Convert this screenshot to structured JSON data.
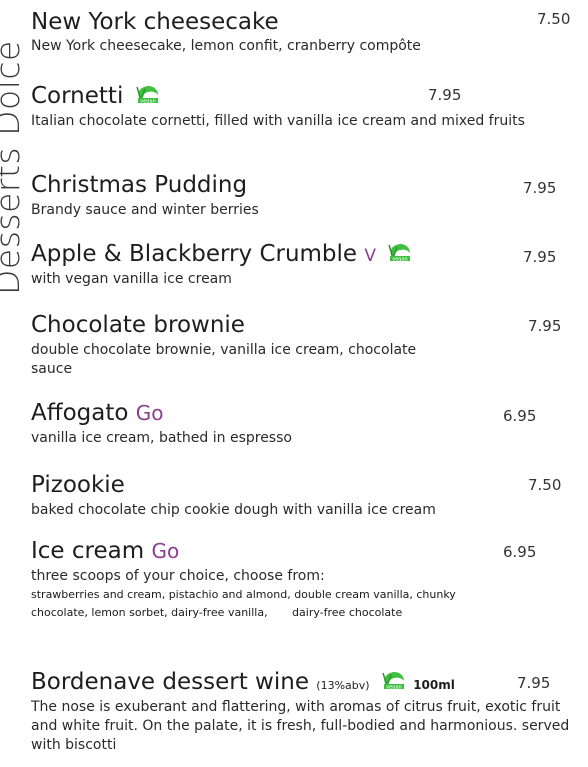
{
  "page": {
    "side_title": "Desserts Dolce"
  },
  "items": [
    {
      "name": "New York cheesecake",
      "price": "7.50",
      "desc": "New York cheesecake, lemon confit, cranberry compôte"
    },
    {
      "name": "Cornetti",
      "price": "7.95",
      "desc": "Italian chocolate cornetti, filled with vanilla ice cream and mixed fruits",
      "badge": "vegan-logo-icon"
    },
    {
      "name": "Christmas Pudding",
      "price": "7.95",
      "desc": "Brandy sauce and winter berries"
    },
    {
      "name": "Apple & Blackberry Crumble",
      "tag": "V",
      "price": "7.95",
      "desc": "with vegan vanilla ice cream",
      "badge": "vegan-logo-icon"
    },
    {
      "name": "Chocolate brownie",
      "price": "7.95",
      "desc": "double chocolate brownie, vanilla ice cream, chocolate sauce"
    },
    {
      "name": "Affogato",
      "tag": "Go",
      "price": "6.95",
      "desc": "vanilla ice cream, bathed in espresso"
    },
    {
      "name": "Pizookie",
      "price": "7.50",
      "desc": "baked chocolate chip cookie dough with vanilla ice cream"
    },
    {
      "name": "Ice cream",
      "tag": "Go",
      "price": "6.95",
      "desc": "three scoops of your choice, choose from:",
      "desc2": "strawberries and cream, pistachio and almond, double cream vanilla, chunky chocolate, lemon sorbet, dairy-free vanilla,       dairy-free chocolate"
    },
    {
      "name": "Bordenave dessert wine",
      "abv": "(13%abv)",
      "size": "100ml",
      "price": "7.95",
      "desc": "The nose is exuberant and flattering, with aromas of citrus fruit, exotic fruit and white fruit. On the palate, it is fresh, full-bodied and harmonious. served with biscotti",
      "badge": "vegan-logo-icon"
    }
  ],
  "colors": {
    "go_tag": "#8b3f8f",
    "vegan_green": "#3fbf3f"
  }
}
